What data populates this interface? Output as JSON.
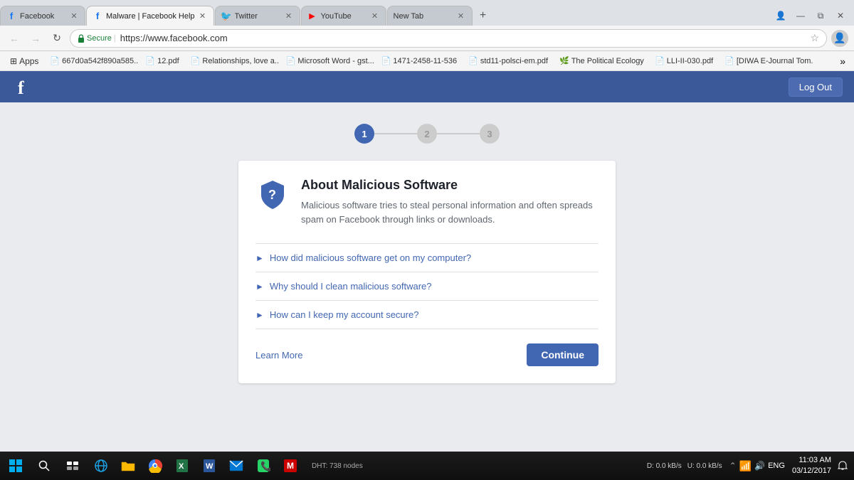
{
  "browser": {
    "tabs": [
      {
        "id": "tab1",
        "title": "Facebook",
        "favicon": "fb",
        "active": false,
        "url": ""
      },
      {
        "id": "tab2",
        "title": "Malware | Facebook Help",
        "favicon": "fb",
        "active": true,
        "url": ""
      },
      {
        "id": "tab3",
        "title": "Twitter",
        "favicon": "tw",
        "active": false,
        "url": ""
      },
      {
        "id": "tab4",
        "title": "YouTube",
        "favicon": "yt",
        "active": false,
        "url": ""
      },
      {
        "id": "tab5",
        "title": "New Tab",
        "favicon": "",
        "active": false,
        "url": ""
      }
    ],
    "address": "https://www.facebook.com",
    "secure_label": "Secure",
    "bookmarks": [
      {
        "label": "Apps",
        "icon": "⊞"
      },
      {
        "label": "667d0a542f890a585...",
        "icon": "📄"
      },
      {
        "label": "12.pdf",
        "icon": "📄"
      },
      {
        "label": "Relationships, love a...",
        "icon": "📄"
      },
      {
        "label": "Microsoft Word - gst...",
        "icon": "📄"
      },
      {
        "label": "1471-2458-11-536",
        "icon": "📄"
      },
      {
        "label": "std11-polsci-em.pdf",
        "icon": "📄"
      },
      {
        "label": "The Political Ecology",
        "icon": "🌿"
      },
      {
        "label": "LLI-II-030.pdf",
        "icon": "📄"
      },
      {
        "label": "[DIWA E-Journal Tom...",
        "icon": "📄"
      }
    ]
  },
  "facebook": {
    "header": {
      "logo": "f",
      "logout_label": "Log Out"
    },
    "steps": [
      {
        "number": "1",
        "active": true
      },
      {
        "number": "2",
        "active": false
      },
      {
        "number": "3",
        "active": false
      }
    ],
    "card": {
      "title": "About Malicious Software",
      "description": "Malicious software tries to steal personal information and often spreads spam on Facebook through links or downloads.",
      "faq": [
        {
          "question": "How did malicious software get on my computer?"
        },
        {
          "question": "Why should I clean malicious software?"
        },
        {
          "question": "How can I keep my account secure?"
        }
      ],
      "learn_more": "Learn More",
      "continue": "Continue"
    }
  },
  "taskbar": {
    "time": "11:03 AM",
    "date": "03/12/2017",
    "network_label": "DHT: 738 nodes",
    "dl_label": "D: 0.0 kB/s",
    "ul_label": "U: 0.0 kB/s",
    "lang": "ENG"
  }
}
